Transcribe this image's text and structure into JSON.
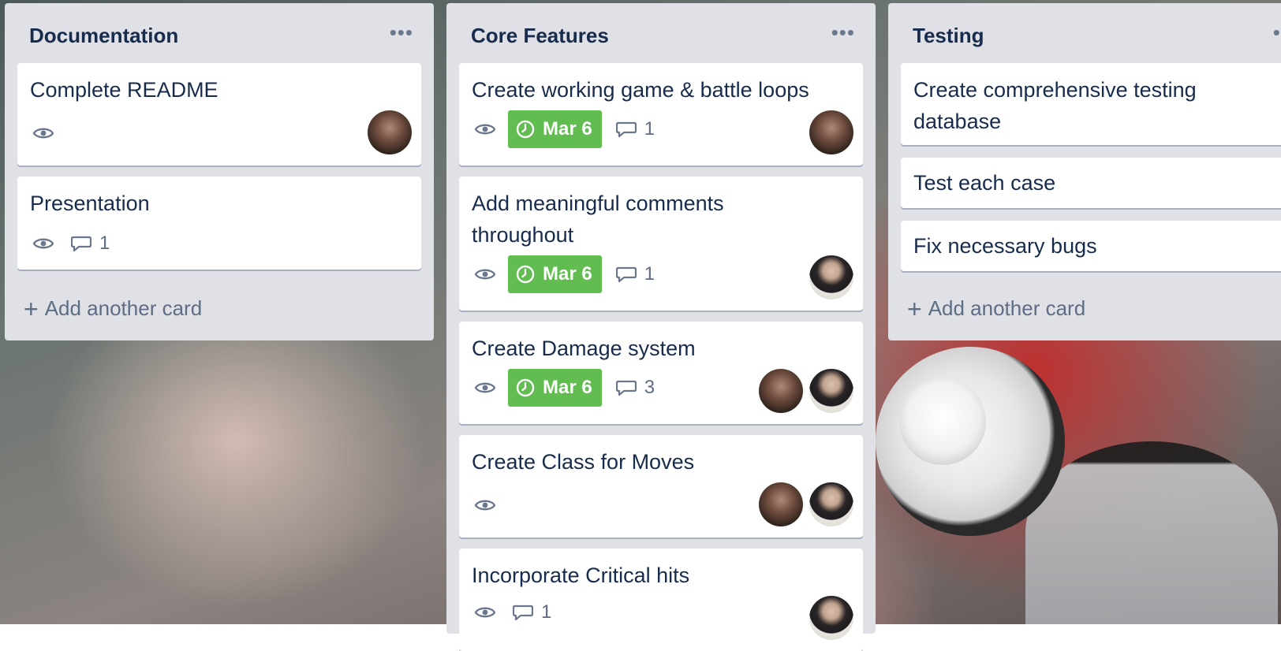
{
  "lists": [
    {
      "title": "Documentation",
      "menu": "•••",
      "cards": [
        {
          "title": "Complete README"
        },
        {
          "title": "Presentation",
          "comments": "1"
        }
      ],
      "add_label": "Add another card"
    },
    {
      "title": "Core Features",
      "menu": "•••",
      "cards": [
        {
          "title": "Create working game & battle loops",
          "due": "Mar 6",
          "comments": "1"
        },
        {
          "title": "Add meaningful comments throughout",
          "due": "Mar 6",
          "comments": "1"
        },
        {
          "title": "Create Damage system",
          "due": "Mar 6",
          "comments": "3"
        },
        {
          "title": "Create Class for Moves"
        },
        {
          "title": "Incorporate Critical hits",
          "comments": "1"
        }
      ]
    },
    {
      "title": "Testing",
      "menu": "•••",
      "cards": [
        {
          "title": "Create comprehensive testing database"
        },
        {
          "title": "Test each case"
        },
        {
          "title": "Fix necessary bugs"
        }
      ],
      "add_label": "Add another card"
    }
  ],
  "colors": {
    "due_badge": "#61bd4f",
    "list_bg": "#dfe1e6",
    "text": "#172b4d"
  },
  "icons": [
    "eye-icon",
    "clock-icon",
    "comment-icon",
    "plus-icon",
    "more-icon"
  ]
}
